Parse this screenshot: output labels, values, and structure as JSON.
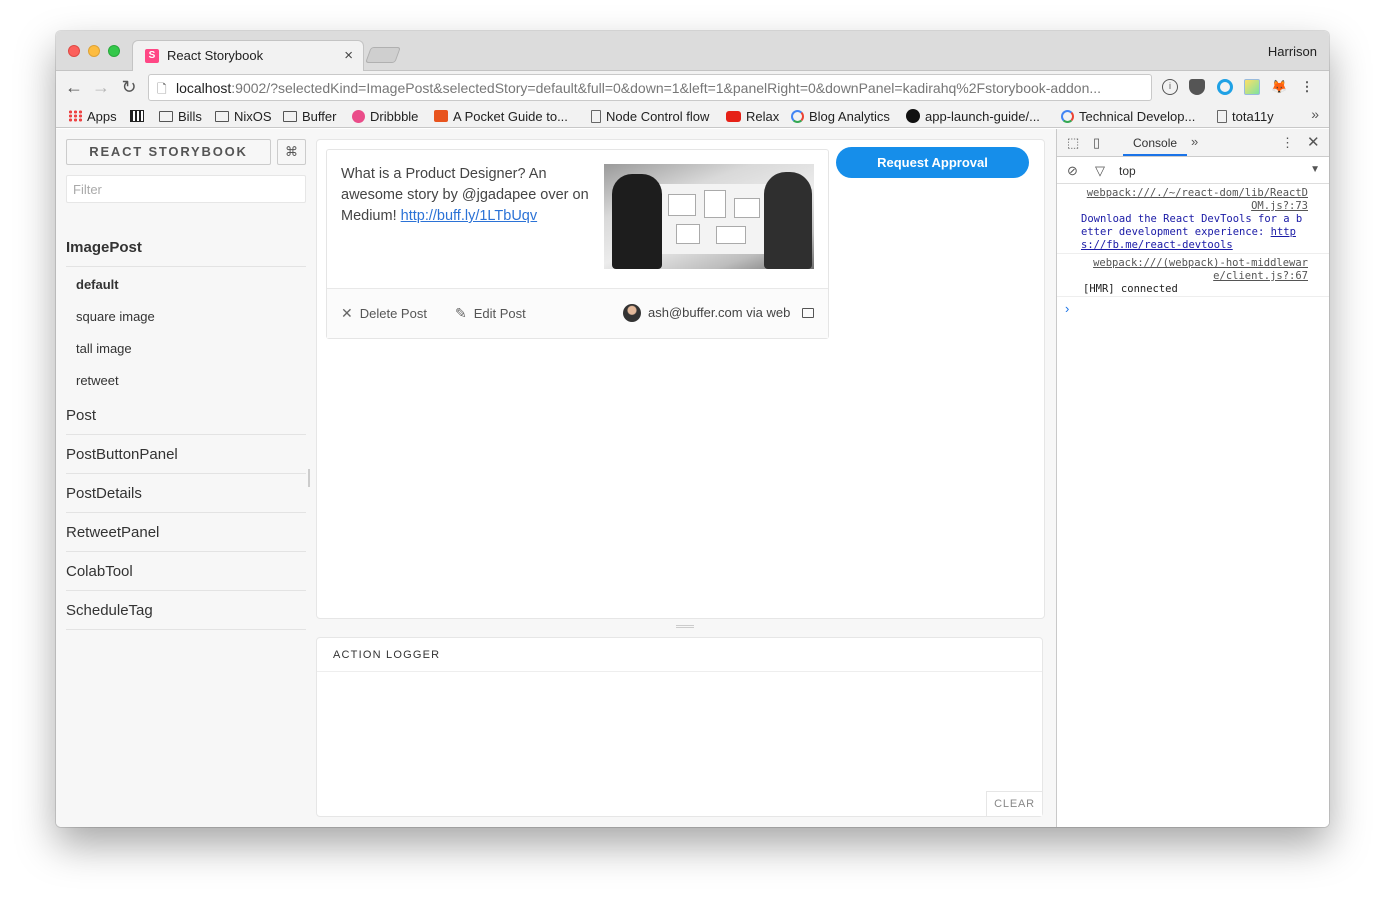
{
  "browser": {
    "tab_title": "React Storybook",
    "tab_favicon": "S",
    "tab_close": "×",
    "profile": "Harrison",
    "url_host": "localhost",
    "url_rest": ":9002/?selectedKind=ImagePost&selectedStory=default&full=0&down=1&left=1&panelRight=0&downPanel=kadirahq%2Fstorybook-addon...",
    "nav": {
      "back": "←",
      "forward": "→",
      "reload": "↻"
    },
    "ext_menu": "⋮"
  },
  "bookmarks": [
    {
      "label": "Apps",
      "icon": "apps-grid-icon"
    },
    {
      "label": "",
      "icon": "qr-icon"
    },
    {
      "label": "Bills",
      "icon": "folder-icon"
    },
    {
      "label": "NixOS",
      "icon": "folder-icon"
    },
    {
      "label": "Buffer",
      "icon": "folder-icon"
    },
    {
      "label": "Dribbble",
      "icon": "dribbble-icon"
    },
    {
      "label": "A Pocket Guide to...",
      "icon": "pocket-icon"
    },
    {
      "label": "Node Control flow",
      "icon": "page-icon"
    },
    {
      "label": "Relax",
      "icon": "youtube-icon"
    },
    {
      "label": "Blog Analytics",
      "icon": "google-icon"
    },
    {
      "label": "app-launch-guide/...",
      "icon": "github-icon"
    },
    {
      "label": "Technical Develop...",
      "icon": "google-icon"
    },
    {
      "label": "tota11y",
      "icon": "page-icon"
    }
  ],
  "bookmarks_more": "»",
  "storybook": {
    "title": "REACT STORYBOOK",
    "shortcut": "⌘",
    "filter_placeholder": "Filter",
    "kinds": [
      {
        "name": "ImagePost",
        "active": true,
        "stories": [
          "default",
          "square image",
          "tall image",
          "retweet"
        ]
      },
      {
        "name": "Post"
      },
      {
        "name": "PostButtonPanel"
      },
      {
        "name": "PostDetails"
      },
      {
        "name": "RetweetPanel"
      },
      {
        "name": "ColabTool"
      },
      {
        "name": "ScheduleTag"
      }
    ],
    "active_story": "default"
  },
  "post": {
    "text": "What is a Product Designer? An awesome story by @jgadapee over on Medium! ",
    "link": "http://buff.ly/1LTbUqv",
    "delete_label": "Delete Post",
    "edit_label": "Edit Post",
    "via": "ash@buffer.com via web",
    "delete_icon": "✕",
    "edit_icon": "✎"
  },
  "approve_label": "Request Approval",
  "logger": {
    "tab": "ACTION LOGGER",
    "clear": "CLEAR"
  },
  "devtools": {
    "console_tab": "Console",
    "more_tabs": "»",
    "context": "top",
    "context_arrow": "▼",
    "messages": [
      {
        "source": "webpack:///./~/react-dom/lib/ReactDOM.js?:73",
        "text": "Download the React DevTools for a better development experience: ",
        "link": "https://fb.me/react-devtools"
      },
      {
        "source": "webpack:///(webpack)-hot-middleware/client.js?:67",
        "text": "[HMR] connected"
      }
    ],
    "prompt": "›"
  }
}
